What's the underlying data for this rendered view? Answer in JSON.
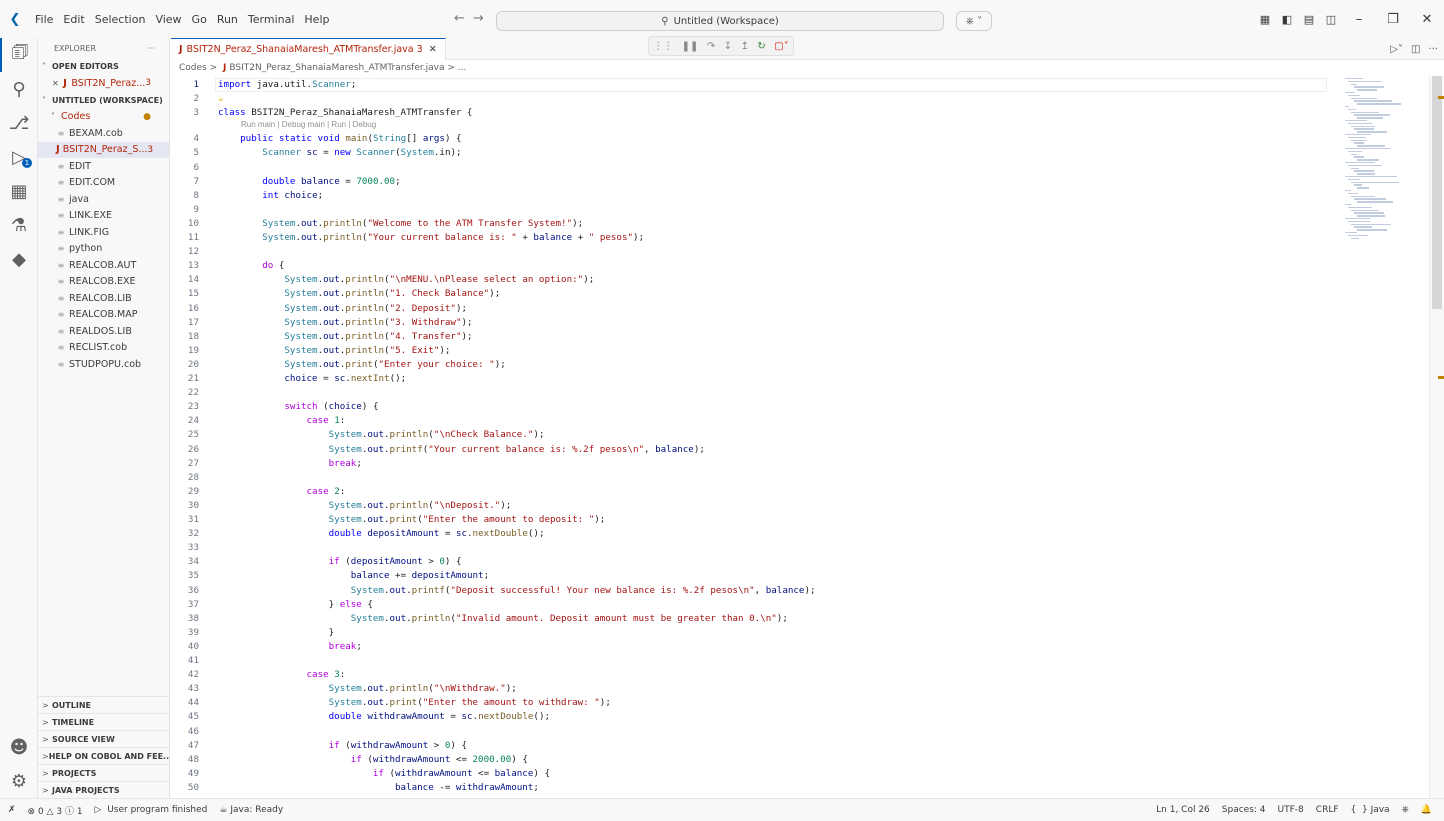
{
  "titlebar": {
    "menus": [
      "File",
      "Edit",
      "Selection",
      "View",
      "Go",
      "Run",
      "Terminal",
      "Help"
    ],
    "search_text": "Untitled (Workspace)"
  },
  "sidebar": {
    "title": "EXPLORER",
    "more": "···",
    "open_editors_label": "OPEN EDITORS",
    "open_editor_file": "BSIT2N_Peraz...",
    "open_editor_count": "3",
    "workspace_label": "UNTITLED (WORKSPACE)",
    "folder_label": "Codes",
    "files": [
      {
        "name": "BEXAM.cob",
        "type": "file"
      },
      {
        "name": "BSIT2N_Peraz_S...",
        "type": "java",
        "count": "3"
      },
      {
        "name": "EDIT",
        "type": "file"
      },
      {
        "name": "EDIT.COM",
        "type": "file"
      },
      {
        "name": "java",
        "type": "file"
      },
      {
        "name": "LINK.EXE",
        "type": "file"
      },
      {
        "name": "LINK.FIG",
        "type": "file"
      },
      {
        "name": "python",
        "type": "file"
      },
      {
        "name": "REALCOB.AUT",
        "type": "file"
      },
      {
        "name": "REALCOB.EXE",
        "type": "file"
      },
      {
        "name": "REALCOB.LIB",
        "type": "file"
      },
      {
        "name": "REALCOB.MAP",
        "type": "file"
      },
      {
        "name": "REALDOS.LIB",
        "type": "file"
      },
      {
        "name": "RECLIST.cob",
        "type": "file"
      },
      {
        "name": "STUDPOPU.cob",
        "type": "file"
      }
    ],
    "bottom_sections": [
      "OUTLINE",
      "TIMELINE",
      "SOURCE VIEW",
      "HELP ON COBOL AND FEE...",
      "PROJECTS",
      "JAVA PROJECTS"
    ]
  },
  "tab": {
    "label": "BSIT2N_Peraz_ShanaiaMaresh_ATMTransfer.java",
    "problems": "3"
  },
  "breadcrumb": {
    "folder": "Codes",
    "file": "BSIT2N_Peraz_ShanaiaMaresh_ATMTransfer.java",
    "tail": "..."
  },
  "codelens": "Run main | Debug main | Run | Debug",
  "code_lines": [
    "import java.util.Scanner;",
    "",
    "class BSIT2N_Peraz_ShanaiaMaresh_ATMTransfer {",
    "    public static void main(String[] args) {",
    "        Scanner sc = new Scanner(System.in);",
    "",
    "        double balance = 7000.00;",
    "        int choice;",
    "",
    "        System.out.println(\"Welcome to the ATM Transfer System!\");",
    "        System.out.println(\"Your current balance is: \" + balance + \" pesos\");",
    "",
    "        do {",
    "            System.out.println(\"\\nMENU.\\nPlease select an option:\");",
    "            System.out.println(\"1. Check Balance\");",
    "            System.out.println(\"2. Deposit\");",
    "            System.out.println(\"3. Withdraw\");",
    "            System.out.println(\"4. Transfer\");",
    "            System.out.println(\"5. Exit\");",
    "            System.out.print(\"Enter your choice: \");",
    "            choice = sc.nextInt();",
    "",
    "            switch (choice) {",
    "                case 1:",
    "                    System.out.println(\"\\nCheck Balance.\");",
    "                    System.out.printf(\"Your current balance is: %.2f pesos\\n\", balance);",
    "                    break;",
    "",
    "                case 2:",
    "                    System.out.println(\"\\nDeposit.\");",
    "                    System.out.print(\"Enter the amount to deposit: \");",
    "                    double depositAmount = sc.nextDouble();",
    "",
    "                    if (depositAmount > 0) {",
    "                        balance += depositAmount;",
    "                        System.out.printf(\"Deposit successful! Your new balance is: %.2f pesos\\n\", balance);",
    "                    } else {",
    "                        System.out.println(\"Invalid amount. Deposit amount must be greater than 0.\\n\");",
    "                    }",
    "                    break;",
    "",
    "                case 3:",
    "                    System.out.println(\"\\nWithdraw.\");",
    "                    System.out.print(\"Enter the amount to withdraw: \");",
    "                    double withdrawAmount = sc.nextDouble();",
    "",
    "                    if (withdrawAmount > 0) {",
    "                        if (withdrawAmount <= 2000.00) {",
    "                            if (withdrawAmount <= balance) {",
    "                                balance -= withdrawAmount;"
  ],
  "status": {
    "problems": "0",
    "warnings": "3",
    "infos": "1",
    "run_status": "User program finished",
    "java_status": "Java: Ready",
    "cursor": "Ln 1, Col 26",
    "spaces": "Spaces: 4",
    "encoding": "UTF-8",
    "eol": "CRLF",
    "language": "Java"
  }
}
